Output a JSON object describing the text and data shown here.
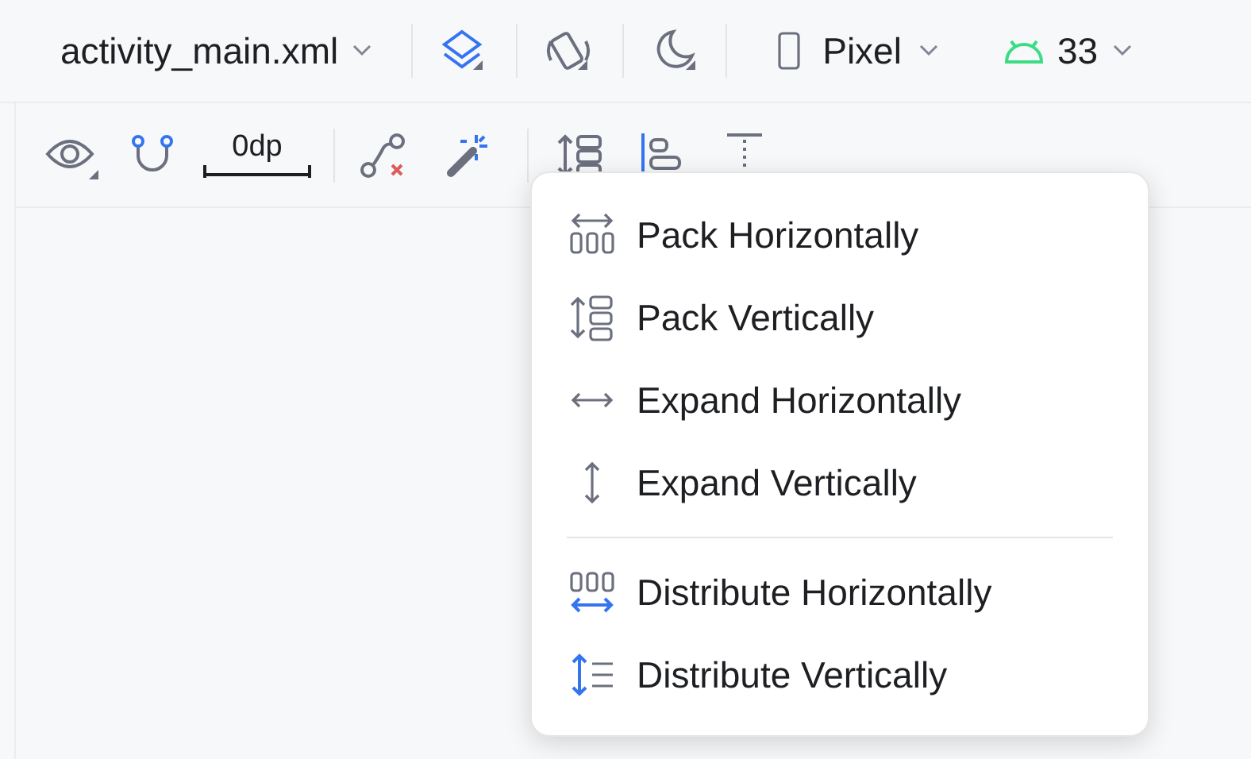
{
  "toolbar": {
    "file": "activity_main.xml",
    "device": "Pixel",
    "api_level": "33"
  },
  "constraint_toolbar": {
    "default_margin": "0dp"
  },
  "align_menu": {
    "groups": [
      [
        {
          "label": "Pack Horizontally",
          "kind": "pack-h"
        },
        {
          "label": "Pack Vertically",
          "kind": "pack-v"
        },
        {
          "label": "Expand Horizontally",
          "kind": "expand-h"
        },
        {
          "label": "Expand Vertically",
          "kind": "expand-v"
        }
      ],
      [
        {
          "label": "Distribute Horizontally",
          "kind": "distribute-h"
        },
        {
          "label": "Distribute Vertically",
          "kind": "distribute-v"
        }
      ]
    ]
  }
}
